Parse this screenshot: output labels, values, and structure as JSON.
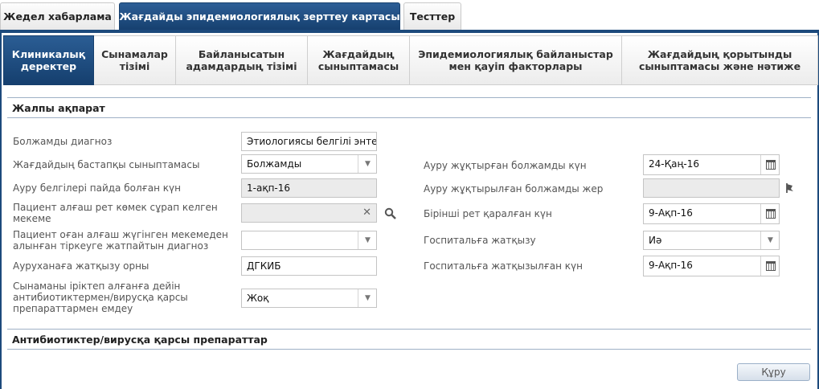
{
  "top_tabs": [
    {
      "label": "Жедел хабарлама"
    },
    {
      "label": "Жағдайды эпидемиологиялық зерттеу картасы"
    },
    {
      "label": "Тесттер"
    }
  ],
  "sub_tabs": [
    {
      "line1": "Клиникалық",
      "line2": "деректер"
    },
    {
      "line1": "Сынамалар",
      "line2": "тізімі"
    },
    {
      "line1": "Байланысатын",
      "line2": "адамдардың тізімі"
    },
    {
      "line1": "Жағдайдың",
      "line2": "сыныптамасы"
    },
    {
      "line1": "Эпидемиологиялық байланыстар",
      "line2": "мен қауіп факторлары"
    },
    {
      "line1": "Жағдайдың қорытынды",
      "line2": "сыныптамасы және нәтиже"
    }
  ],
  "section_general": "Жалпы ақпарат",
  "section_antibiotics": "Антибиотиктер/вирусқа қарсы препараттар",
  "left_fields": {
    "diagnosis": {
      "label": "Болжамды диагноз",
      "value": "Этиологиясы белгілі энтері"
    },
    "initial_class": {
      "label": "Жағдайдың бастапқы сыныптамасы",
      "value": "Болжамды"
    },
    "symptom_date": {
      "label": "Ауру белгілері пайда болған күн",
      "value": "1-ақп-16"
    },
    "first_facility": {
      "label1": "Пациент алғаш рет көмек сұрап келген",
      "label2": "мекеме",
      "value": ""
    },
    "first_diag": {
      "label1": "Пациент оған алғаш жүгінген мекемеден",
      "label2": "алынған тіркеуге жатпайтын диагноз",
      "value": ""
    },
    "hospital": {
      "label": "Ауруханаға жатқызу орны",
      "value": "ДГКИБ"
    },
    "treatment": {
      "label1": "Сынаманы іріктеп алғанға дейін",
      "label2": "антибиотиктермен/вирусқа қарсы",
      "label3": "препараттармен емдеу",
      "value": "Жоқ"
    }
  },
  "right_fields": {
    "infection_date": {
      "label": "Ауру жұқтырған болжамды күн",
      "value": "24-Қаң-16"
    },
    "infection_place": {
      "label": "Ауру жұқтырылған болжамды жер",
      "value": ""
    },
    "first_exam": {
      "label": "Бірінші рет қаралған күн",
      "value": "9-Ақп-16"
    },
    "hospitalization": {
      "label": "Госпитальға жатқызу",
      "value": "Иә"
    },
    "hosp_date": {
      "label": "Госпитальға жатқызылған күн",
      "value": "9-Ақп-16"
    }
  },
  "footer": {
    "build_label": "Құру"
  },
  "icons": {
    "dropdown": "▼",
    "clear": "✕"
  },
  "colors": {
    "accent": "#1d4a7c",
    "tab_active": "#16406f"
  }
}
